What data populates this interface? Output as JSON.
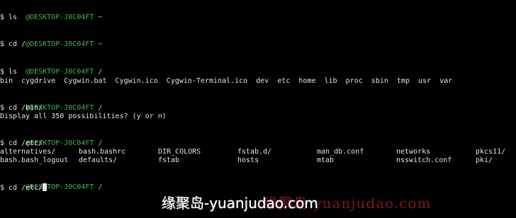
{
  "terminal": {
    "blocks": [
      {
        "prompt_host": "@DESKTOP-J0C04FT",
        "prompt_path": "~",
        "command": "$ ls"
      },
      {
        "prompt_host": "@DESKTOP-J0C04FT",
        "prompt_path": "~",
        "command": "$ cd /"
      },
      {
        "prompt_host": "@DESKTOP-J0C04FT",
        "prompt_path": "/",
        "command": "$ ls",
        "output": "bin  cygdrive  Cygwin.bat  Cygwin.ico  Cygwin-Terminal.ico  dev  etc  home  lib  proc  sbin  tmp  usr  var"
      },
      {
        "prompt_host": "@DESKTOP-J0C04FT",
        "prompt_path": "/",
        "command": "$ cd /bin/",
        "output": "Display all 350 possibilities? (y or n)"
      },
      {
        "prompt_host": "@DESKTOP-J0C04FT",
        "prompt_path": "/",
        "command": "$ cd /etc/"
      },
      {
        "prompt_host": "@DESKTOP-J0C04FT",
        "prompt_path": "/",
        "command": "$ cd /etc/"
      }
    ],
    "etc_listing": [
      [
        "alternatives/",
        "bash.bashrc",
        "DIR_COLORS",
        "fstab.d/",
        "man_db.conf",
        "networks",
        "pkcs11/"
      ],
      [
        "bash.bash_logout",
        "defaults/",
        "fstab",
        "hosts",
        "mtab",
        "nsswitch.conf",
        "pki/"
      ]
    ]
  },
  "watermark": {
    "main": "缘聚岛-yuanjudao.com",
    "faded": "缘聚岛 yuanjudao.com"
  }
}
